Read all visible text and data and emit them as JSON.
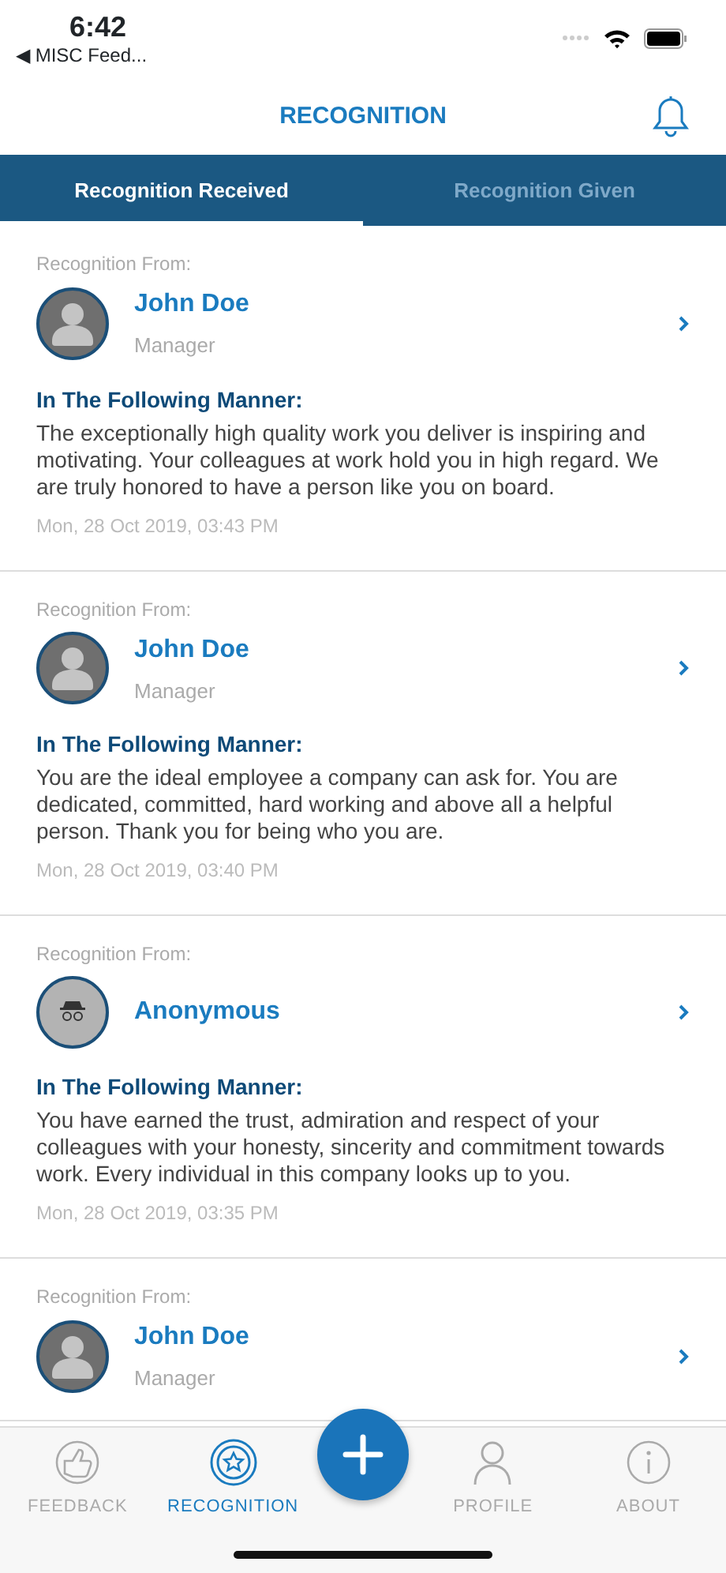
{
  "status_bar": {
    "time": "6:42",
    "back_label": "◀ MISC Feed..."
  },
  "header": {
    "title": "RECOGNITION"
  },
  "tabs": [
    {
      "label": "Recognition Received",
      "selected": true
    },
    {
      "label": "Recognition Given",
      "selected": false
    }
  ],
  "recognitions": [
    {
      "kind": "person",
      "from_label": "Recognition From:",
      "name": "John Doe",
      "role": "Manager",
      "manner_label": "In The Following Manner:",
      "message": "The exceptionally high quality work you deliver is inspiring and motivating. Your colleagues at work hold you in high regard. We are truly honored to have a person like you on board.",
      "date": "Mon, 28 Oct 2019, 03:43 PM"
    },
    {
      "kind": "person",
      "from_label": "Recognition From:",
      "name": "John Doe",
      "role": "Manager",
      "manner_label": "In The Following Manner:",
      "message": "You are the ideal employee a company can ask for. You are dedicated, committed, hard working and above all a helpful person. Thank you for being who you are.",
      "date": "Mon, 28 Oct 2019, 03:40 PM"
    },
    {
      "kind": "anonymous",
      "from_label": "Recognition From:",
      "name": "Anonymous",
      "manner_label": "In The Following Manner:",
      "message": "You have earned the trust, admiration and respect of your colleagues with your honesty, sincerity and commitment towards work. Every individual in this company looks up to you.",
      "date": "Mon, 28 Oct 2019, 03:35 PM"
    },
    {
      "kind": "person",
      "from_label": "Recognition From:",
      "name": "John Doe",
      "role": "Manager"
    }
  ],
  "tab_bar": [
    {
      "kind": "feedback",
      "label": "FEEDBACK",
      "selected": false
    },
    {
      "kind": "recognition",
      "label": "RECOGNITION",
      "selected": true
    },
    {
      "kind": "add"
    },
    {
      "kind": "profile",
      "label": "PROFILE",
      "selected": false
    },
    {
      "kind": "about",
      "label": "ABOUT",
      "selected": false
    }
  ]
}
